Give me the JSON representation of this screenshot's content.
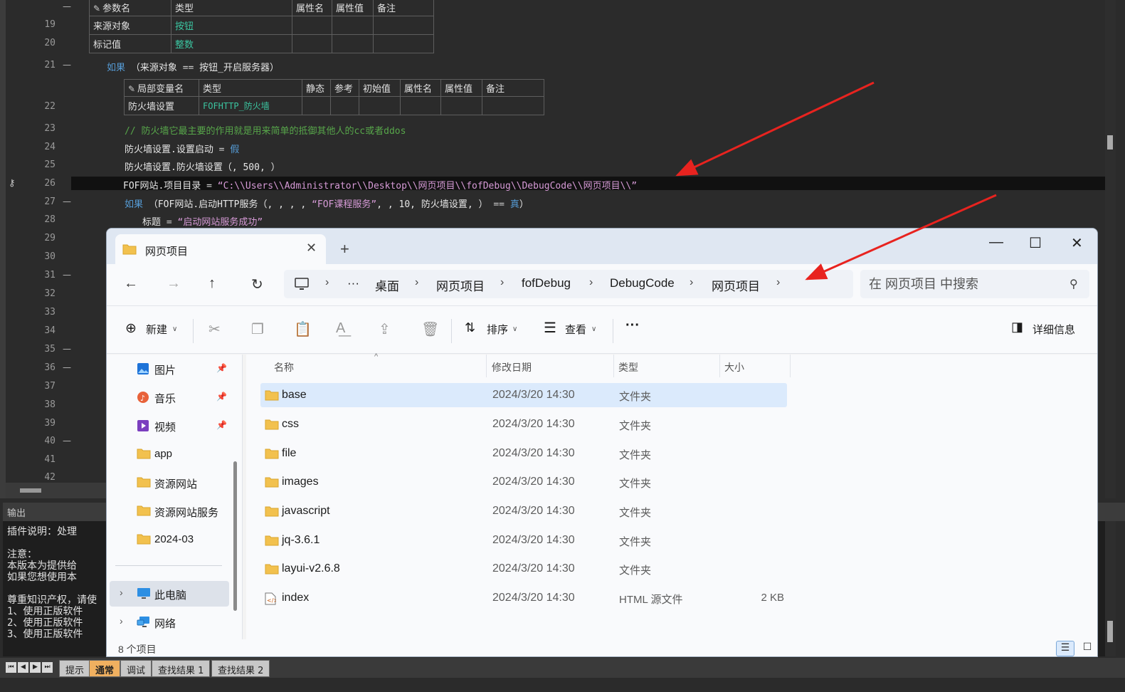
{
  "ide": {
    "line_numbers": [
      "19",
      "20",
      "21",
      "22",
      "23",
      "24",
      "25",
      "26",
      "27",
      "28",
      "29",
      "30",
      "31",
      "32",
      "33",
      "34",
      "35",
      "36",
      "37",
      "38",
      "39",
      "40",
      "41",
      "42"
    ],
    "fold_marks": [
      "—",
      "—",
      "—",
      "—",
      "—",
      "—",
      "—",
      "—"
    ],
    "param_table": {
      "header": [
        "参数名",
        "类型",
        "属性名",
        "属性值",
        "备注"
      ],
      "rows": [
        [
          "来源对象",
          "按钮"
        ],
        [
          "标记值",
          "整数"
        ]
      ]
    },
    "line21": {
      "kw": "如果",
      "text": "（来源对象",
      "op": "==",
      "text2": "按钮_开启服务器）"
    },
    "local_table": {
      "header": [
        "局部变量名",
        "类型",
        "静态",
        "参考",
        "初始值",
        "属性名",
        "属性值",
        "备注"
      ],
      "row": [
        "防火墙设置",
        "FOFHTTP_防火墙"
      ]
    },
    "line23_comment": "// 防火墙它最主要的作用就是用来简单的抵御其他人的cc或者ddos",
    "line24": {
      "text": "防火墙设置.设置启动",
      "op": "=",
      "kw": "假"
    },
    "line25": "防火墙设置.防火墙设置（, 500, ）",
    "line26": {
      "text": "FOF网站.项目目录",
      "op": "=",
      "str": "“C:\\\\Users\\\\Administrator\\\\Desktop\\\\网页项目\\\\fofDebug\\\\DebugCode\\\\网页项目\\\\”"
    },
    "line27": {
      "kw": "如果",
      "text": "（FOF网站.启动HTTP服务（, , , ,",
      "str": "“FOF课程服务”",
      "text2": ", , 10, 防火墙设置, ）",
      "op": "==",
      "kw2": "真",
      "end": "）"
    },
    "line28": {
      "text": "标题",
      "op": "=",
      "str": "“启动网站服务成功”"
    },
    "output_title": "输出",
    "output_lines": [
      "    插件说明：处理",
      "注意：",
      "    本版本为提供给",
      "    如果您想使用本",
      "尊重知识产权，请使",
      "    1、使用正版软件",
      "    2、使用正版软件",
      "    3、使用正版软件"
    ],
    "bottom_tabs": [
      "提示",
      "通常",
      "调试",
      "查找结果 1",
      "查找结果 2"
    ],
    "nav_buttons": [
      "⏮",
      "◀",
      "▶",
      "⏭"
    ]
  },
  "explorer": {
    "tab_title": "网页项目",
    "tab_add": "+",
    "window_buttons": {
      "minimize": "—",
      "maximize": "☐",
      "close": "✕"
    },
    "nav": {
      "back": "←",
      "forward": "→",
      "up": "↑",
      "refresh": "↻"
    },
    "breadcrumb": {
      "more": "···",
      "items": [
        "桌面",
        "网页项目",
        "fofDebug",
        "DebugCode",
        "网页项目"
      ],
      "sep": "›"
    },
    "search": {
      "placeholder": "在 网页项目 中搜索"
    },
    "toolbar": {
      "new": "新建",
      "sort": "排序",
      "view": "查看",
      "more": "···",
      "details": "详细信息"
    },
    "sidebar": [
      {
        "label": "图片",
        "icon": "pictures-icon",
        "pinned": true
      },
      {
        "label": "音乐",
        "icon": "music-icon",
        "pinned": true
      },
      {
        "label": "视频",
        "icon": "videos-icon",
        "pinned": true
      },
      {
        "label": "app",
        "icon": "folder-icon"
      },
      {
        "label": "资源网站",
        "icon": "folder-icon"
      },
      {
        "label": "资源网站服务",
        "icon": "folder-icon"
      },
      {
        "label": "2024-03",
        "icon": "folder-icon"
      },
      {
        "label": "此电脑",
        "icon": "computer-icon",
        "expand": true,
        "selected": true
      },
      {
        "label": "网络",
        "icon": "network-icon",
        "expand": true
      }
    ],
    "columns": [
      "名称",
      "修改日期",
      "类型",
      "大小"
    ],
    "files": [
      {
        "name": "base",
        "date": "2024/3/20 14:30",
        "type": "文件夹",
        "size": "",
        "kind": "folder",
        "selected": true
      },
      {
        "name": "css",
        "date": "2024/3/20 14:30",
        "type": "文件夹",
        "size": "",
        "kind": "folder"
      },
      {
        "name": "file",
        "date": "2024/3/20 14:30",
        "type": "文件夹",
        "size": "",
        "kind": "folder"
      },
      {
        "name": "images",
        "date": "2024/3/20 14:30",
        "type": "文件夹",
        "size": "",
        "kind": "folder"
      },
      {
        "name": "javascript",
        "date": "2024/3/20 14:30",
        "type": "文件夹",
        "size": "",
        "kind": "folder"
      },
      {
        "name": "jq-3.6.1",
        "date": "2024/3/20 14:30",
        "type": "文件夹",
        "size": "",
        "kind": "folder"
      },
      {
        "name": "layui-v2.6.8",
        "date": "2024/3/20 14:30",
        "type": "文件夹",
        "size": "",
        "kind": "folder"
      },
      {
        "name": "index",
        "date": "2024/3/20 14:30",
        "type": "HTML 源文件",
        "size": "2 KB",
        "kind": "html"
      }
    ],
    "status": {
      "count": "8 个项目"
    },
    "colors": {
      "folder": "#f2c14e",
      "selection": "#dbeafc",
      "arrow": "#e8231f"
    }
  }
}
